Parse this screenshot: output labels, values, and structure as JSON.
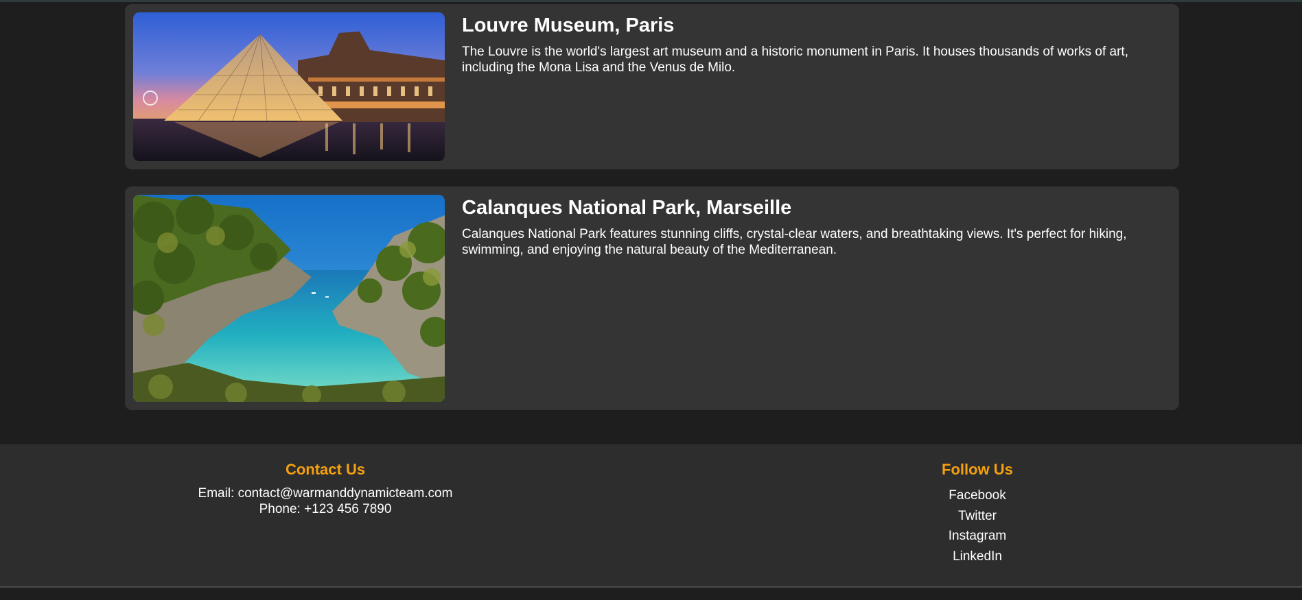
{
  "destinations": [
    {
      "title": "Louvre Museum, Paris",
      "description": "The Louvre is the world's largest art museum and a historic monument in Paris. It houses thousands of works of art, including the Mona Lisa and the Venus de Milo."
    },
    {
      "title": "Calanques National Park, Marseille",
      "description": "Calanques National Park features stunning cliffs, crystal-clear waters, and breathtaking views. It's perfect for hiking, swimming, and enjoying the natural beauty of the Mediterranean."
    }
  ],
  "footer": {
    "contact": {
      "heading": "Contact Us",
      "email": "Email: contact@warmanddynamicteam.com",
      "phone": "Phone: +123 456 7890"
    },
    "follow": {
      "heading": "Follow Us",
      "links": [
        "Facebook",
        "Twitter",
        "Instagram",
        "LinkedIn"
      ]
    }
  },
  "colors": {
    "page_background": "#1e1e1e",
    "card_background": "#343434",
    "footer_background": "#2d2d2d",
    "accent": "#f5a00f",
    "text": "#ffffff"
  }
}
